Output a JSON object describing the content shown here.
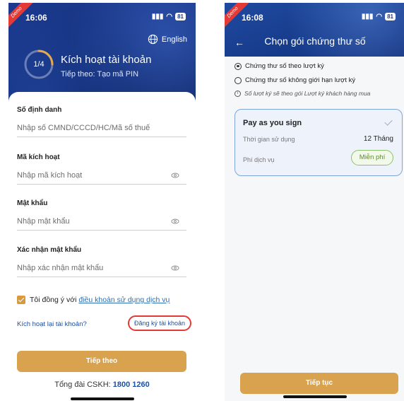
{
  "colors": {
    "header_blue": "#1c3a8f",
    "accent_gold": "#d8a24f",
    "link_blue": "#1f4fa0",
    "highlight_red": "#e53935",
    "badge_green": "#5c8a2c"
  },
  "screen1": {
    "demo_label": "Demo",
    "status_time": "16:06",
    "battery": "81",
    "language_label": "English",
    "step_counter": "1/4",
    "step_progress": 0.25,
    "title": "Kích hoạt tài khoản",
    "subtitle": "Tiếp theo: Tạo mã PIN",
    "fields": [
      {
        "label": "Số định danh",
        "placeholder": "Nhập số CMND/CCCD/HC/Mã số thuế",
        "icon": ""
      },
      {
        "label": "Mã kích hoạt",
        "placeholder": "Nhập mã kích hoạt",
        "icon": "eye-icon"
      },
      {
        "label": "Mật khẩu",
        "placeholder": "Nhập mật khẩu",
        "icon": "eye-icon"
      },
      {
        "label": "Xác nhận mật khẩu",
        "placeholder": "Nhập xác nhận mật khẩu",
        "icon": "eye-icon"
      }
    ],
    "agree_text": "Tôi đồng ý với",
    "agree_link": "điều khoản sử dụng dịch vụ",
    "reactivate_link": "Kích hoạt lại tài khoản?",
    "register_link": "Đăng ký tài khoản",
    "next_button": "Tiếp theo",
    "hotline_label": "Tổng đài CSKH:",
    "hotline_number": "1800 1260"
  },
  "screen2": {
    "demo_label": "Demo",
    "status_time": "16:08",
    "battery": "81",
    "title": "Chọn gói chứng thư số",
    "options": [
      {
        "label": "Chứng thư số theo lượt ký",
        "selected": true
      },
      {
        "label": "Chứng thư số không giới hạn lượt ký",
        "selected": false
      }
    ],
    "info_text": "Số lượt ký sẽ theo gói Lượt ký khách hàng mua",
    "package": {
      "name": "Pay as you sign",
      "duration_label": "Thời gian sử dụng",
      "duration_value": "12 Tháng",
      "fee_label": "Phí dịch vụ",
      "fee_value": "Miễn phí"
    },
    "continue_button": "Tiếp tục"
  }
}
